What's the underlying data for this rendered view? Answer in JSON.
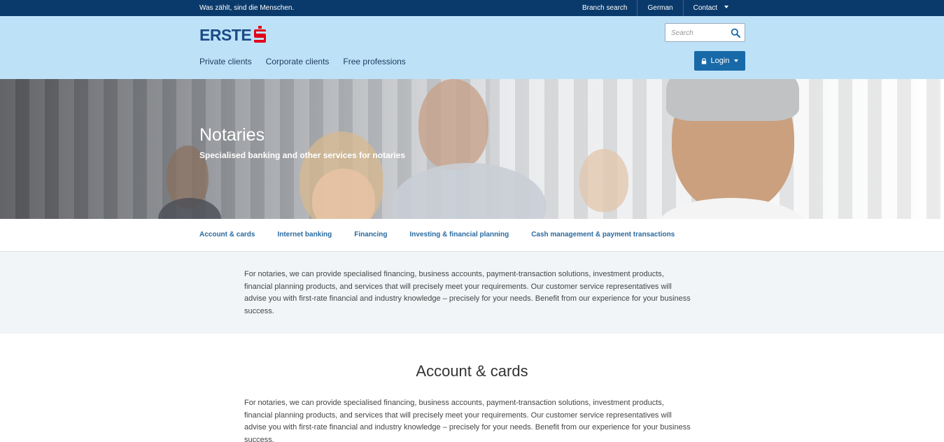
{
  "topbar": {
    "slogan": "Was zählt, sind die Menschen.",
    "links": [
      "Branch search",
      "German",
      "Contact"
    ]
  },
  "header": {
    "logo_text": "ERSTE",
    "search": {
      "placeholder": "Search",
      "value": ""
    },
    "nav": [
      "Private clients",
      "Corporate clients",
      "Free professions"
    ],
    "login_label": "Login"
  },
  "hero": {
    "title": "Notaries",
    "subtitle": "Specialised banking and other services for notaries"
  },
  "subnav": {
    "tabs": [
      "Account & cards",
      "Internet banking",
      "Financing",
      "Investing & financial planning",
      "Cash management & payment transactions"
    ]
  },
  "intro": {
    "text": "For notaries, we can provide specialised financing, business accounts, payment-transaction solutions, investment products, financial planning products, and services that will precisely meet your requirements. Our customer service representatives will advise you with first-rate financial and industry knowledge – precisely for your needs. Benefit from our experience for your business success."
  },
  "account_section": {
    "title": "Account & cards",
    "text": "For notaries, we can provide specialised financing, business accounts, payment-transaction solutions, investment products, financial planning products, and services that will precisely meet your requirements. Our customer service representatives will advise you with first-rate financial and industry knowledge – precisely for your needs. Benefit from our experience for your business success."
  },
  "colors": {
    "topbar_bg": "#0a3a6b",
    "header_bg": "#bde2f8",
    "brand_blue": "#1b4a86",
    "brand_red": "#e2001a",
    "login_bg": "#1869a8",
    "link_blue": "#2a6aa0"
  },
  "icons": [
    "search-icon",
    "lock-icon",
    "chevron-down-icon",
    "erste-s-logo-icon"
  ]
}
